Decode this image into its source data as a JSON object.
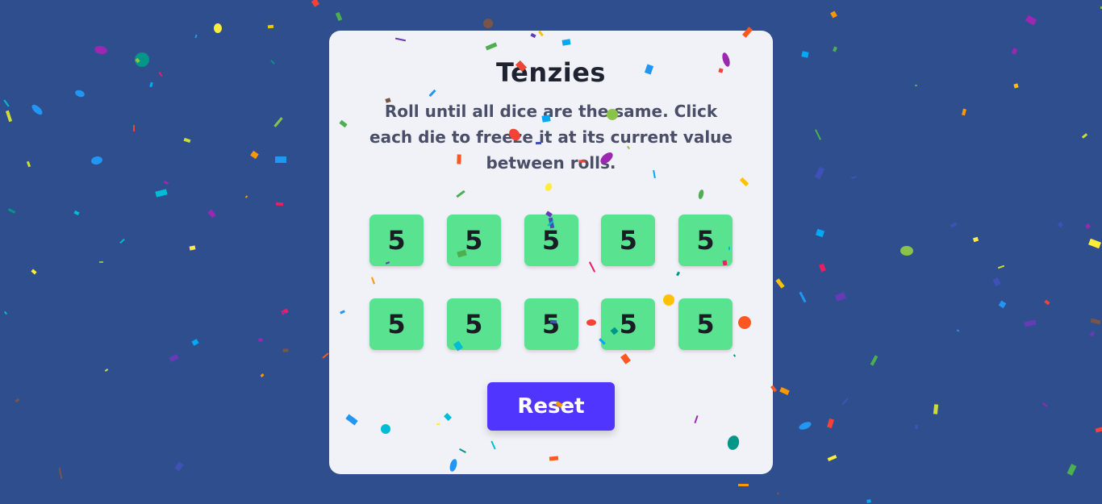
{
  "game": {
    "title": "Tenzies",
    "instructions": "Roll until all dice are the same. Click each die to freeze it at its current value between rolls.",
    "dice": [
      {
        "value": "5",
        "held": true
      },
      {
        "value": "5",
        "held": true
      },
      {
        "value": "5",
        "held": true
      },
      {
        "value": "5",
        "held": true
      },
      {
        "value": "5",
        "held": true
      },
      {
        "value": "5",
        "held": true
      },
      {
        "value": "5",
        "held": true
      },
      {
        "value": "5",
        "held": true
      },
      {
        "value": "5",
        "held": true
      },
      {
        "value": "5",
        "held": true
      }
    ],
    "reset_label": "Reset",
    "won": true
  },
  "colors": {
    "background": "#2f4e8d",
    "card": "#f0f2f7",
    "die_held": "#59e391",
    "button": "#5035ff",
    "title_text": "#1f2230",
    "body_text": "#4a4e69"
  },
  "confetti_palette": [
    "#f44336",
    "#e91e63",
    "#9c27b0",
    "#673ab7",
    "#3f51b5",
    "#2196f3",
    "#03a9f4",
    "#00bcd4",
    "#009688",
    "#4caf50",
    "#8bc34a",
    "#cddc39",
    "#ffeb3b",
    "#ffc107",
    "#ff9800",
    "#ff5722",
    "#795548"
  ]
}
